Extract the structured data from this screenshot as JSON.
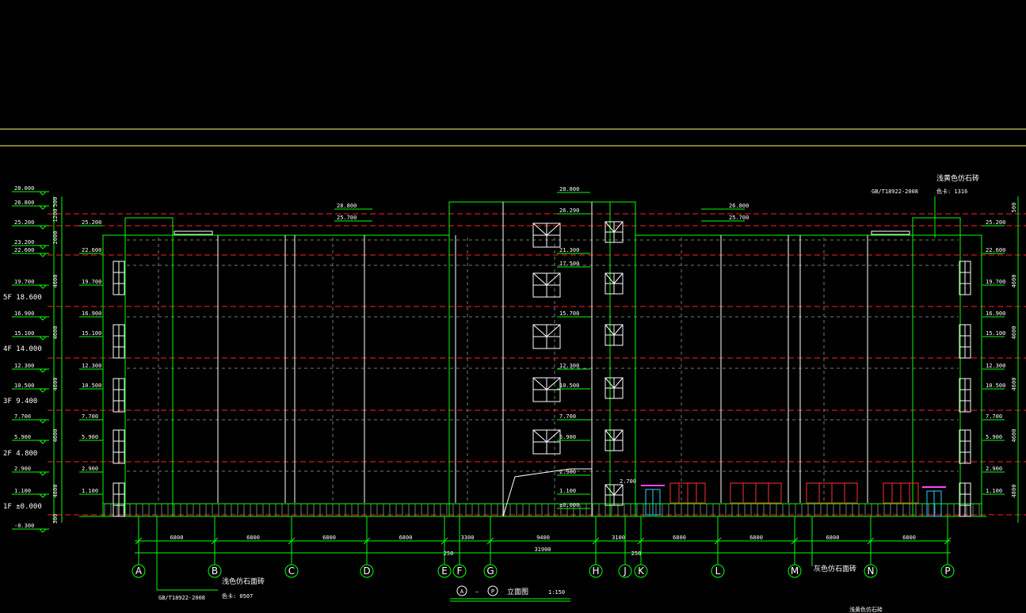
{
  "colors": {
    "background": "#000000",
    "building": "#00ff00",
    "floor_line": "#ff2020",
    "guide": "#ffff66",
    "text": "#ffffff",
    "window_red": "#ff3030",
    "door_cyan": "#33ccff",
    "canopy_magenta": "#ff44ff"
  },
  "axes": [
    "A",
    "B",
    "C",
    "D",
    "E",
    "F",
    "G",
    "H",
    "J",
    "K",
    "L",
    "M",
    "N",
    "P"
  ],
  "bay_dims": [
    "6800",
    "6800",
    "6800",
    "6800",
    "3300",
    "9400",
    "3100",
    "6800",
    "6800",
    "6800",
    "6800"
  ],
  "sub_dims": [
    "250",
    "31900",
    "250"
  ],
  "left_elevations": [
    "28.000",
    "26.800",
    "25.200",
    "23.200",
    "22.600",
    "19.700",
    "16.900",
    "15.100",
    "12.300",
    "10.500",
    "7.700",
    "5.900",
    "2.900",
    "1.100",
    "-0.300"
  ],
  "right_elevations": [
    "25.200",
    "22.600",
    "19.700",
    "16.900",
    "15.100",
    "12.300",
    "10.500",
    "7.700",
    "5.900",
    "2.900",
    "1.100"
  ],
  "center_elevations": [
    "28.800",
    "26.290",
    "21.300",
    "17.500",
    "15.700",
    "12.300",
    "10.500",
    "7.700",
    "5.900",
    "2.900",
    "1.100",
    "±0.000"
  ],
  "stair_labels": [
    "28.800",
    "25.700"
  ],
  "right_top_labels": [
    "26.800",
    "25.700"
  ],
  "floors": [
    "5F 18.600",
    "4F 14.000",
    "3F 9.400",
    "2F 4.800",
    "1F ±0.000"
  ],
  "vert_dims": [
    "500",
    "1200",
    "2000",
    "4600",
    "4600",
    "4600",
    "4600",
    "4800",
    "300"
  ],
  "right_vert_dims": [
    "500",
    "4600",
    "4600",
    "4600",
    "4600",
    "4800"
  ],
  "annotations": {
    "standard_left": "GB/T18922-2008",
    "color_left": "浅色仿石面砖",
    "card_left": "色卡: 0507",
    "standard_right": "GB/T18922-2008",
    "color_right": "浅黄色仿石砖",
    "card_right": "色卡: 1316",
    "bottom_mid_note": "灰色仿石面砖",
    "bottom_right_cut": "浅黄色仿石砖"
  },
  "title": {
    "from": "A",
    "dash": "—",
    "to": "P",
    "name": "立面图",
    "scale": "1:150"
  },
  "door_small_label": "2.700"
}
